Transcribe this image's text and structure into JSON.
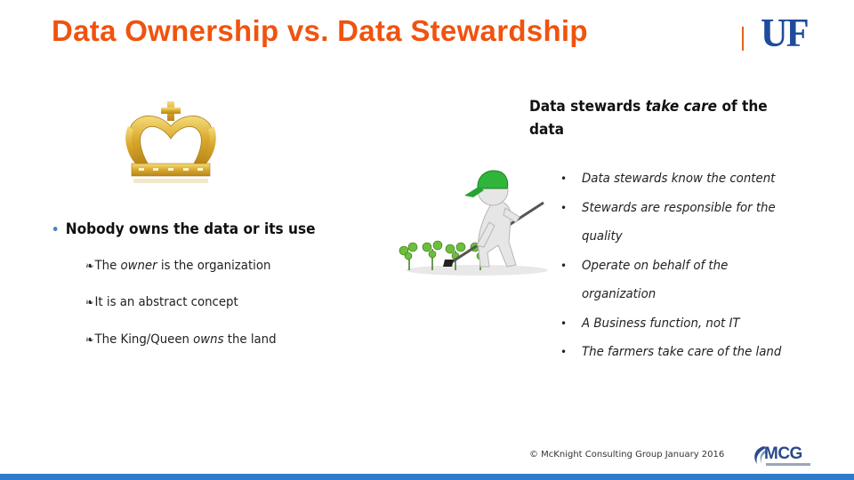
{
  "slide": {
    "title": "Data Ownership vs. Data Stewardship",
    "logo_text": "UF",
    "colors": {
      "title": "#f0530f",
      "logo": "#1f4b9b",
      "divider": "#e2631c",
      "bullet_dot": "#4f81bd",
      "bottom_bar": "#2e7bc9"
    }
  },
  "images": {
    "crown": "crown-illustration",
    "farmer": "stick-figure-farmer-hoeing-plants"
  },
  "left": {
    "bullet": "•",
    "heading": "Nobody owns the data or its use",
    "sub_glyph": "❧",
    "items": [
      {
        "pre": "The ",
        "em": "owner",
        "post": " is the organization"
      },
      {
        "pre": "It is an abstract concept",
        "em": "",
        "post": ""
      },
      {
        "pre": "The King/Queen ",
        "em": "owns",
        "post": " the land"
      }
    ]
  },
  "right": {
    "heading_pre": "Data stewards ",
    "heading_em": "take care",
    "heading_post": " of the data",
    "bullet": "•",
    "items": [
      "Data stewards know the content",
      "Stewards are responsible for the quality",
      "Operate on behalf of the organization",
      "A Business function, not IT",
      "The farmers take care of the land"
    ]
  },
  "footer": {
    "copyright": "© McKnight Consulting Group January 2016",
    "logo_text": "MCG"
  }
}
